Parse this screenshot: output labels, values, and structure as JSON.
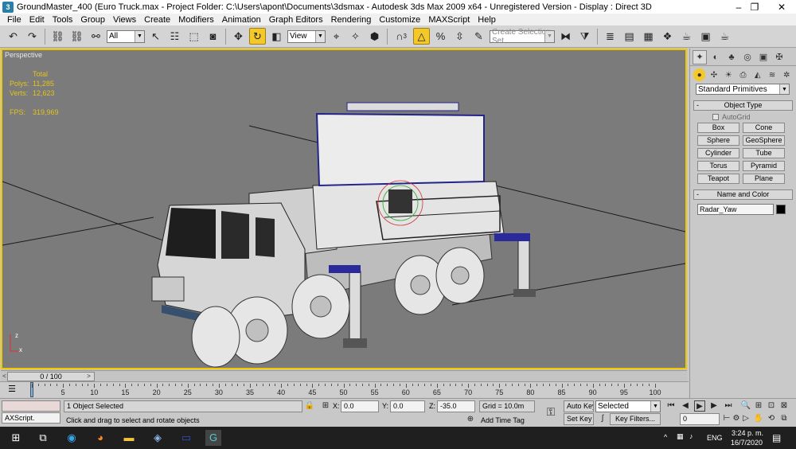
{
  "window": {
    "title": "GroundMaster_400 (Euro Truck.max  - Project Folder: C:\\Users\\apont\\Documents\\3dsmax  - Autodesk 3ds Max  2009 x64  - Unregistered Version   - Display : Direct 3D",
    "app_icon": "3ds-max-icon",
    "minimize": "–",
    "maximize": "❐",
    "close": "✕"
  },
  "menu": [
    "File",
    "Edit",
    "Tools",
    "Group",
    "Views",
    "Create",
    "Modifiers",
    "Animation",
    "Graph Editors",
    "Rendering",
    "Customize",
    "MAXScript",
    "Help"
  ],
  "toolbar": {
    "selection_filter": "All",
    "reference_coord": "View",
    "named_selection_placeholder": "Create Selection Set",
    "snap_label": "3"
  },
  "viewport": {
    "label": "Perspective",
    "stats": {
      "header": "Total",
      "polys_label": "Polys:",
      "polys": "11,285",
      "verts_label": "Verts:",
      "verts": "12,623",
      "fps_label": "FPS:",
      "fps": "319,969"
    },
    "axis": {
      "z": "z",
      "x": "x"
    }
  },
  "command_panel": {
    "category": "Standard Primitives",
    "object_type_title": "Object Type",
    "autogrid": "AutoGrid",
    "primitives": [
      "Box",
      "Cone",
      "Sphere",
      "GeoSphere",
      "Cylinder",
      "Tube",
      "Torus",
      "Pyramid",
      "Teapot",
      "Plane"
    ],
    "name_color_title": "Name and Color",
    "object_name": "Radar_Yaw",
    "object_color": "#000000"
  },
  "timeline": {
    "frame_display": "0 / 100",
    "ticks": [
      0,
      5,
      10,
      15,
      20,
      25,
      30,
      35,
      40,
      45,
      50,
      55,
      60,
      65,
      70,
      75,
      80,
      85,
      90,
      95,
      100
    ]
  },
  "status": {
    "maxscript": "AXScript.",
    "selection": "1 Object Selected",
    "prompt": "Click and drag to select and rotate objects",
    "x_label": "X:",
    "x": "0.0",
    "y_label": "Y:",
    "y": "0.0",
    "z_label": "Z:",
    "z": "-35.0",
    "grid": "Grid = 10.0m",
    "add_time_tag": "Add Time Tag",
    "auto_key": "Auto Key",
    "set_key": "Set Key",
    "key_mode": "Selected",
    "key_filters": "Key Filters...",
    "current_frame": "0"
  },
  "taskbar": {
    "language": "ENG",
    "time": "3:24 p. m.",
    "date": "16/7/2020"
  }
}
